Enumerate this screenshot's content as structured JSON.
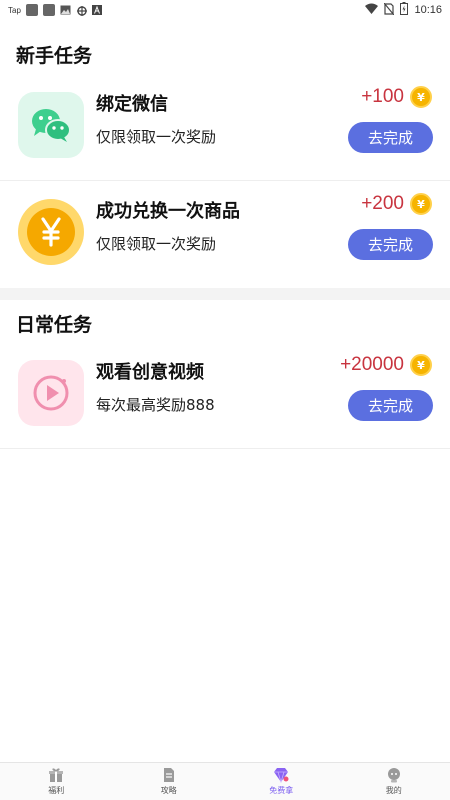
{
  "status_bar": {
    "left_text": "Tap",
    "time": "10:16"
  },
  "sections": {
    "newbie": {
      "title": "新手任务"
    },
    "daily": {
      "title": "日常任务"
    }
  },
  "tasks": [
    {
      "title": "绑定微信",
      "desc": "仅限领取一次奖励",
      "reward": "+100",
      "coin": "¥",
      "button": "去完成",
      "icon": "wechat-icon"
    },
    {
      "title": "成功兑换一次商品",
      "desc": "仅限领取一次奖励",
      "reward": "+200",
      "coin": "¥",
      "button": "去完成",
      "icon": "yuan-coin-icon"
    },
    {
      "title": "观看创意视频",
      "desc": "每次最高奖励888",
      "reward": "+20000",
      "coin": "¥",
      "button": "去完成",
      "icon": "play-video-icon"
    }
  ],
  "bottom_nav": [
    {
      "label": "福利",
      "icon": "gift-icon",
      "active": false
    },
    {
      "label": "攻略",
      "icon": "document-icon",
      "active": false
    },
    {
      "label": "免费拿",
      "icon": "diamond-icon",
      "active": true
    },
    {
      "label": "我的",
      "icon": "profile-icon",
      "active": false
    }
  ],
  "colors": {
    "accent_button": "#5b6fe0",
    "reward_red": "#c8343f",
    "coin_gold": "#f6b400",
    "active_nav": "#7a5cf0"
  }
}
